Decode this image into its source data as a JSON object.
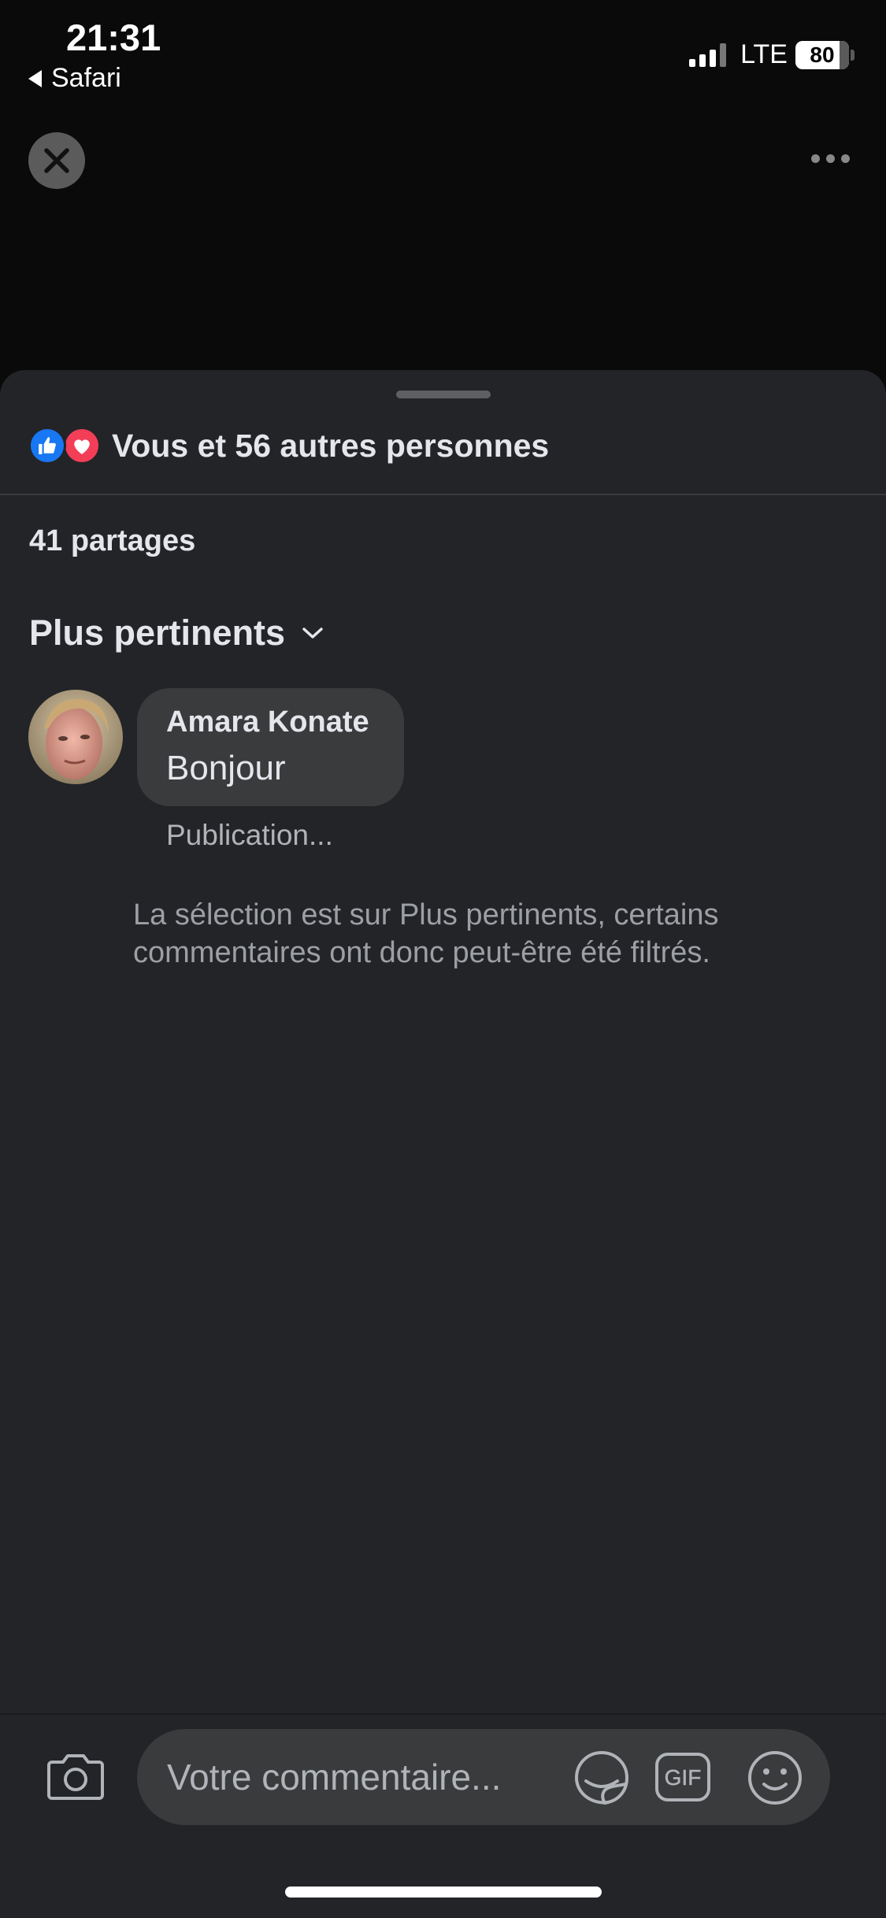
{
  "status_bar": {
    "time": "21:31",
    "back_app": "Safari",
    "network": "LTE",
    "battery": "80"
  },
  "icons": {
    "close": "close-icon",
    "more": "more-icon",
    "like": "like-reaction-icon",
    "love": "love-reaction-icon",
    "sort_chevron": "chevron-down-icon",
    "camera": "camera-icon",
    "sticker": "sticker-icon",
    "gif": "gif-icon",
    "emoji": "emoji-icon"
  },
  "colors": {
    "like": "#1877f2",
    "love": "#f33e58",
    "sheet_bg": "#232427",
    "bubble_bg": "#3a3b3c"
  },
  "reactions": {
    "summary": "Vous et 56 autres personnes"
  },
  "shares": "41 partages",
  "sort": {
    "label": "Plus pertinents"
  },
  "comments": [
    {
      "author": "Amara Konate",
      "text": "Bonjour",
      "status": "Publication..."
    }
  ],
  "filter_note": "La sélection est sur Plus pertinents, certains commentaires ont donc peut-être été filtrés.",
  "composer": {
    "placeholder": "Votre commentaire...",
    "gif_label": "GIF"
  }
}
